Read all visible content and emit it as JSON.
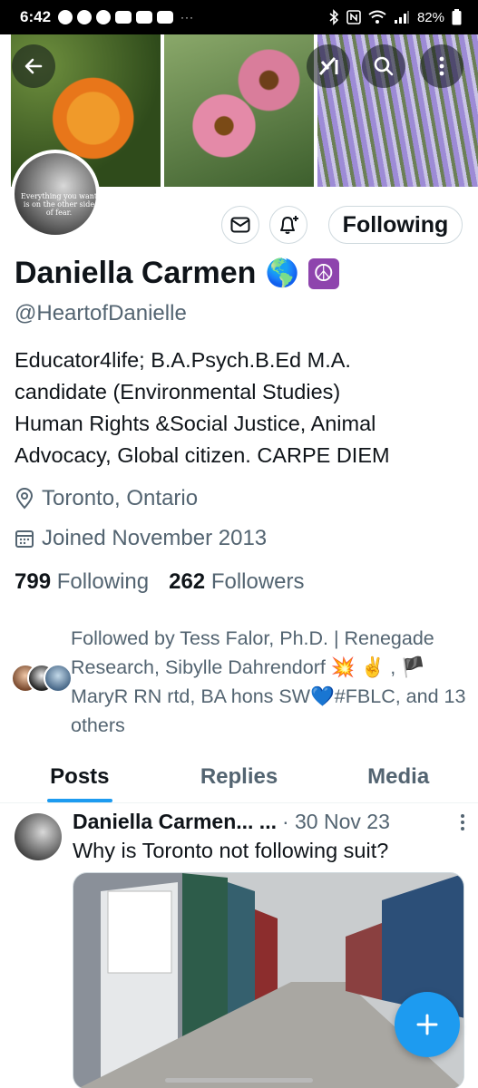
{
  "status_bar": {
    "time": "6:42",
    "battery": "82%",
    "more": "···"
  },
  "header": {
    "back_icon": "arrow-left-icon",
    "grok_icon": "grok-icon",
    "search_icon": "search-icon",
    "more_icon": "more-vertical-icon"
  },
  "profile": {
    "avatar_quote": "Everything you want is on the other side of fear.",
    "name": "Daniella Carmen",
    "name_emojis": [
      "🌎",
      "☮"
    ],
    "handle": "@HeartofDanielle",
    "bio_lines": [
      "Educator4life; B.A.Psych.B.Ed M.A.",
      "candidate (Environmental Studies)",
      "Human Rights &Social Justice, Animal",
      "Advocacy,  Global citizen.  CARPE DIEM"
    ],
    "location": "Toronto, Ontario",
    "joined": "Joined November 2013",
    "following_count": "799",
    "following_label": "Following",
    "followers_count": "262",
    "followers_label": "Followers",
    "following_button": "Following"
  },
  "followed_by": {
    "text": "Followed by Tess Falor, Ph.D. | Renegade Research, Sibylle Dahrendorf 💥 ✌️ , 🏴 MaryR RN rtd, BA hons SW💙#FBLC, and 13 others"
  },
  "tabs": [
    {
      "label": "Posts",
      "active": true
    },
    {
      "label": "Replies",
      "active": false
    },
    {
      "label": "Media",
      "active": false
    }
  ],
  "post": {
    "author": "Daniella Carmen... ...",
    "date": "· 30 Nov 23",
    "text": "Why is Toronto not following suit?"
  },
  "colors": {
    "accent": "#1d9bf0",
    "secondary_text": "#536471",
    "border": "#cfd9de"
  }
}
